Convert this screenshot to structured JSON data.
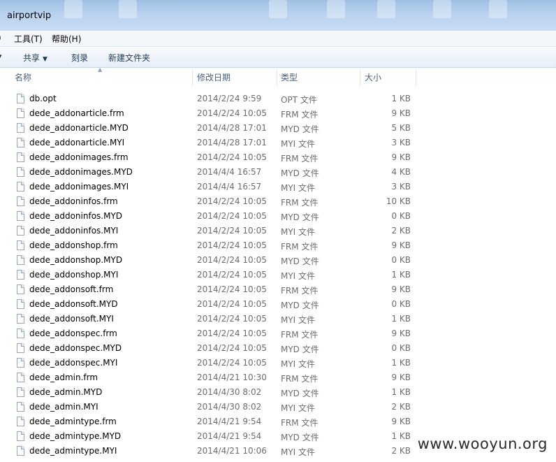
{
  "window": {
    "title": "airportvip"
  },
  "menu": {
    "tools": "工具(T)",
    "help": "帮助(H)"
  },
  "toolbar": {
    "share": "共享",
    "burn": "刻录",
    "new_folder": "新建文件夹"
  },
  "columns": {
    "name": "名称",
    "date": "修改日期",
    "type": "类型",
    "size": "大小"
  },
  "files": [
    {
      "name": "db.opt",
      "date": "2014/2/24 9:59",
      "type": "OPT 文件",
      "size": "1 KB"
    },
    {
      "name": "dede_addonarticle.frm",
      "date": "2014/2/24 10:05",
      "type": "FRM 文件",
      "size": "9 KB"
    },
    {
      "name": "dede_addonarticle.MYD",
      "date": "2014/4/28 17:01",
      "type": "MYD 文件",
      "size": "5 KB"
    },
    {
      "name": "dede_addonarticle.MYI",
      "date": "2014/4/28 17:01",
      "type": "MYI 文件",
      "size": "3 KB"
    },
    {
      "name": "dede_addonimages.frm",
      "date": "2014/2/24 10:05",
      "type": "FRM 文件",
      "size": "9 KB"
    },
    {
      "name": "dede_addonimages.MYD",
      "date": "2014/4/4 16:57",
      "type": "MYD 文件",
      "size": "4 KB"
    },
    {
      "name": "dede_addonimages.MYI",
      "date": "2014/4/4 16:57",
      "type": "MYI 文件",
      "size": "3 KB"
    },
    {
      "name": "dede_addoninfos.frm",
      "date": "2014/2/24 10:05",
      "type": "FRM 文件",
      "size": "10 KB"
    },
    {
      "name": "dede_addoninfos.MYD",
      "date": "2014/2/24 10:05",
      "type": "MYD 文件",
      "size": "0 KB"
    },
    {
      "name": "dede_addoninfos.MYI",
      "date": "2014/2/24 10:05",
      "type": "MYI 文件",
      "size": "2 KB"
    },
    {
      "name": "dede_addonshop.frm",
      "date": "2014/2/24 10:05",
      "type": "FRM 文件",
      "size": "9 KB"
    },
    {
      "name": "dede_addonshop.MYD",
      "date": "2014/2/24 10:05",
      "type": "MYD 文件",
      "size": "0 KB"
    },
    {
      "name": "dede_addonshop.MYI",
      "date": "2014/2/24 10:05",
      "type": "MYI 文件",
      "size": "1 KB"
    },
    {
      "name": "dede_addonsoft.frm",
      "date": "2014/2/24 10:05",
      "type": "FRM 文件",
      "size": "9 KB"
    },
    {
      "name": "dede_addonsoft.MYD",
      "date": "2014/2/24 10:05",
      "type": "MYD 文件",
      "size": "0 KB"
    },
    {
      "name": "dede_addonsoft.MYI",
      "date": "2014/2/24 10:05",
      "type": "MYI 文件",
      "size": "1 KB"
    },
    {
      "name": "dede_addonspec.frm",
      "date": "2014/2/24 10:05",
      "type": "FRM 文件",
      "size": "9 KB"
    },
    {
      "name": "dede_addonspec.MYD",
      "date": "2014/2/24 10:05",
      "type": "MYD 文件",
      "size": "0 KB"
    },
    {
      "name": "dede_addonspec.MYI",
      "date": "2014/2/24 10:05",
      "type": "MYI 文件",
      "size": "1 KB"
    },
    {
      "name": "dede_admin.frm",
      "date": "2014/4/21 10:30",
      "type": "FRM 文件",
      "size": "9 KB"
    },
    {
      "name": "dede_admin.MYD",
      "date": "2014/4/30 8:02",
      "type": "MYD 文件",
      "size": "1 KB"
    },
    {
      "name": "dede_admin.MYI",
      "date": "2014/4/30 8:02",
      "type": "MYI 文件",
      "size": "2 KB"
    },
    {
      "name": "dede_admintype.frm",
      "date": "2014/4/21 9:54",
      "type": "FRM 文件",
      "size": "9 KB"
    },
    {
      "name": "dede_admintype.MYD",
      "date": "2014/4/21 9:54",
      "type": "MYD 文件",
      "size": "1 KB"
    },
    {
      "name": "dede_admintype.MYI",
      "date": "2014/4/21 10:06",
      "type": "MYI 文件",
      "size": "2 KB"
    }
  ],
  "watermark": "www.wooyun.org"
}
